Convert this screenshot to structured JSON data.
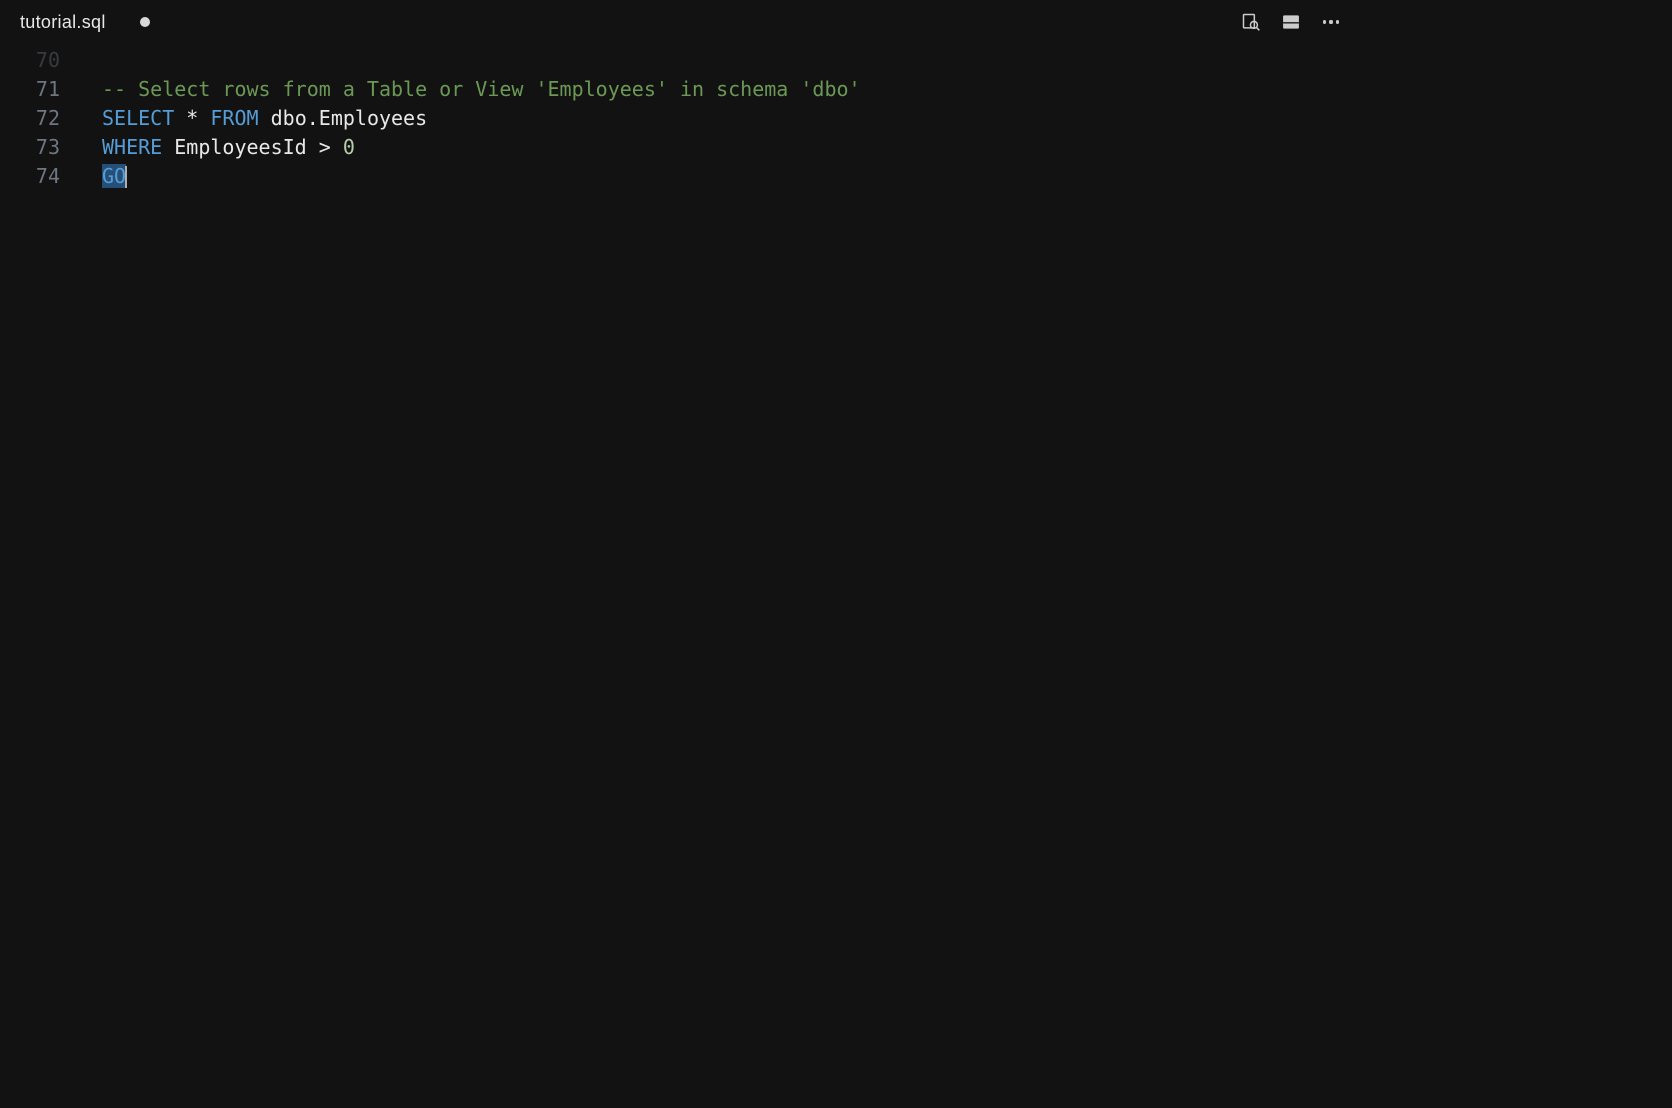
{
  "tab": {
    "filename": "tutorial.sql",
    "dirty": true
  },
  "actions": {
    "search_icon": "search-in-file-icon",
    "split_icon": "split-editor-icon",
    "more_icon": "more-actions-icon"
  },
  "gutter": {
    "lines": [
      "70",
      "71",
      "72",
      "73",
      "74"
    ]
  },
  "code": {
    "l71": {
      "comment": "-- Select rows from a Table or View 'Employees' in schema 'dbo'"
    },
    "l72": {
      "kw_select": "SELECT",
      "star": "*",
      "kw_from": "FROM",
      "table": "dbo.Employees"
    },
    "l73": {
      "kw_where": "WHERE",
      "col": "EmployeesId",
      "op": ">",
      "num": "0"
    },
    "l74": {
      "kw_go": "GO"
    }
  }
}
